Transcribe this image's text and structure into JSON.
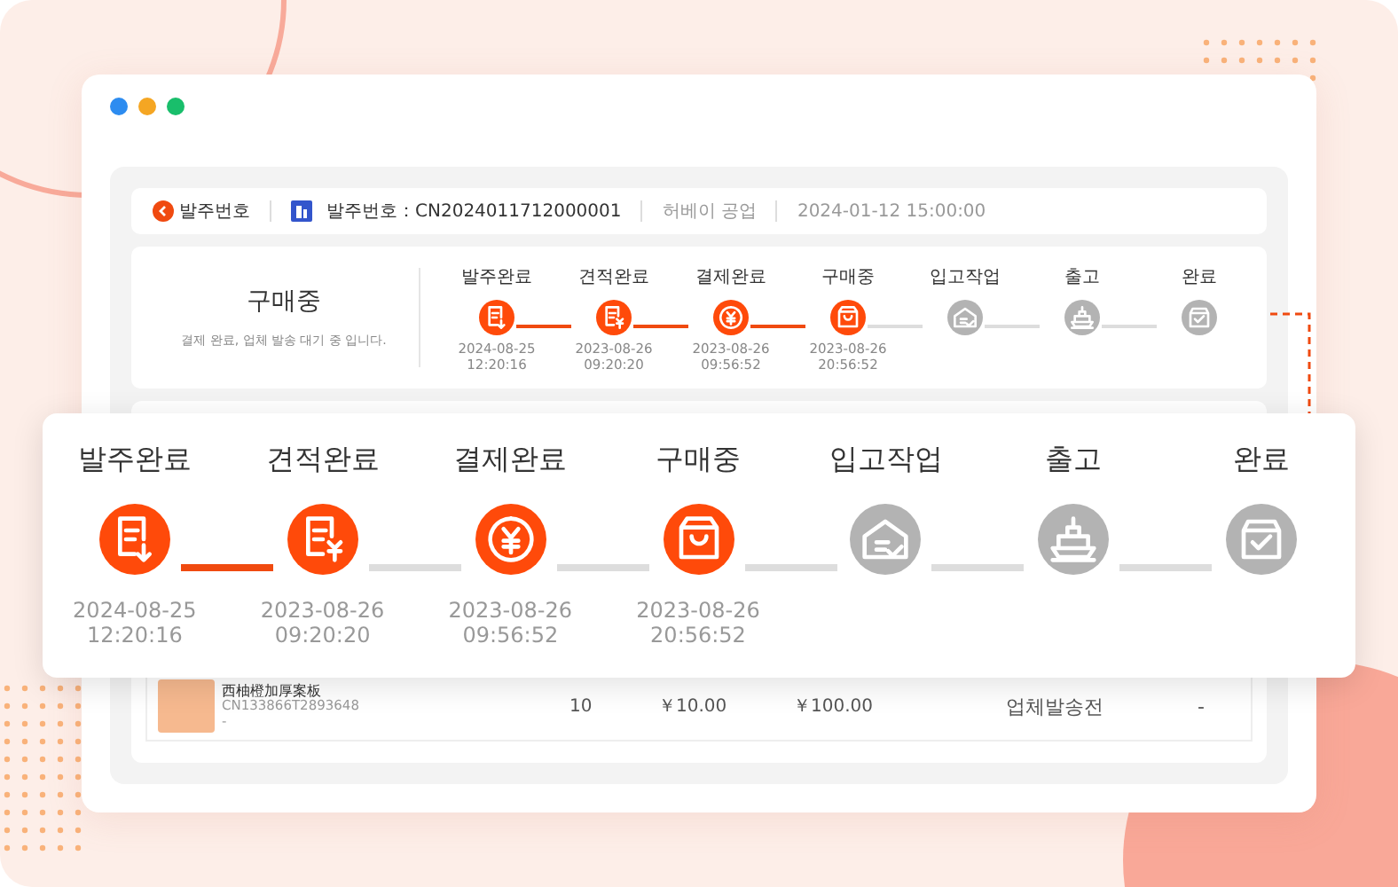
{
  "header": {
    "back_label": "발주번호",
    "order_number": "발주번호：CN2024011712000001",
    "company": "허베이 공업",
    "datetime": "2024-01-12  15:00:00"
  },
  "status_card": {
    "status": "구매중",
    "message": "결제 완료, 업체 발송 대기 중 입니다.",
    "steps": [
      {
        "label": "발주완료",
        "done": true,
        "connector_active": true,
        "date": "2024-08-25",
        "time": "12:20:16"
      },
      {
        "label": "견적완료",
        "done": true,
        "connector_active": true,
        "date": "2023-08-26",
        "time": "09:20:20"
      },
      {
        "label": "결제완료",
        "done": true,
        "connector_active": true,
        "date": "2023-08-26",
        "time": "09:56:52"
      },
      {
        "label": "구매중",
        "done": true,
        "connector_active": false,
        "date": "2023-08-26",
        "time": "20:56:52"
      },
      {
        "label": "입고작업",
        "done": false,
        "connector_active": false
      },
      {
        "label": "출고",
        "done": false,
        "connector_active": false
      },
      {
        "label": "완료",
        "done": false
      }
    ]
  },
  "zoom_card": {
    "steps": [
      {
        "label": "발주완료",
        "done": true,
        "connector_active": true,
        "date": "2024-08-25",
        "time": "12:20:16"
      },
      {
        "label": "견적완료",
        "done": true,
        "connector_active": false,
        "date": "2023-08-26",
        "time": "09:20:20"
      },
      {
        "label": "결제완료",
        "done": true,
        "connector_active": false,
        "date": "2023-08-26",
        "time": "09:56:52"
      },
      {
        "label": "구매중",
        "done": true,
        "connector_active": false,
        "date": "2023-08-26",
        "time": "20:56:52"
      },
      {
        "label": "입고작업",
        "done": false,
        "connector_active": false
      },
      {
        "label": "출고",
        "done": false,
        "connector_active": false
      },
      {
        "label": "완료",
        "done": false
      }
    ]
  },
  "product_row": {
    "name": "西柚橙加厚案板",
    "code": "CN133866T2893648",
    "note": "-",
    "quantity": "10",
    "unit_price": "￥10.00",
    "total": "￥100.00",
    "status": "업체발송전",
    "action": "-"
  }
}
